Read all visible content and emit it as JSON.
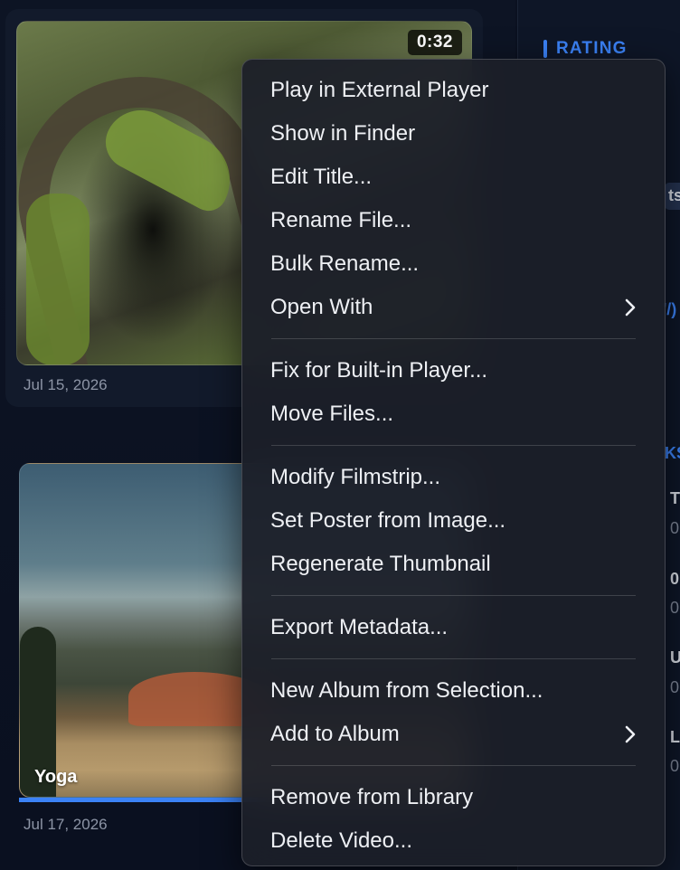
{
  "library": {
    "items": [
      {
        "duration": "0:32",
        "date": "Jul 15, 2026"
      },
      {
        "title": "Yoga",
        "date": "Jul 17, 2026",
        "progress": 0.55
      }
    ]
  },
  "sidebar": {
    "rating_label": "RATING",
    "fragments": [
      "ts",
      "'/)",
      "KS",
      "T",
      "0",
      "0",
      "0",
      "U",
      "0",
      "L",
      "0"
    ]
  },
  "context_menu": {
    "groups": [
      [
        {
          "label": "Play in External Player"
        },
        {
          "label": "Show in Finder"
        },
        {
          "label": "Edit Title..."
        },
        {
          "label": "Rename File..."
        },
        {
          "label": "Bulk Rename..."
        },
        {
          "label": "Open With",
          "submenu": true
        }
      ],
      [
        {
          "label": "Fix for Built-in Player..."
        },
        {
          "label": "Move Files..."
        }
      ],
      [
        {
          "label": "Modify Filmstrip..."
        },
        {
          "label": "Set Poster from Image..."
        },
        {
          "label": "Regenerate Thumbnail"
        }
      ],
      [
        {
          "label": "Export Metadata..."
        }
      ],
      [
        {
          "label": "New Album from Selection..."
        },
        {
          "label": "Add to Album",
          "submenu": true
        }
      ],
      [
        {
          "label": "Remove from Library"
        },
        {
          "label": "Delete Video..."
        }
      ]
    ]
  }
}
